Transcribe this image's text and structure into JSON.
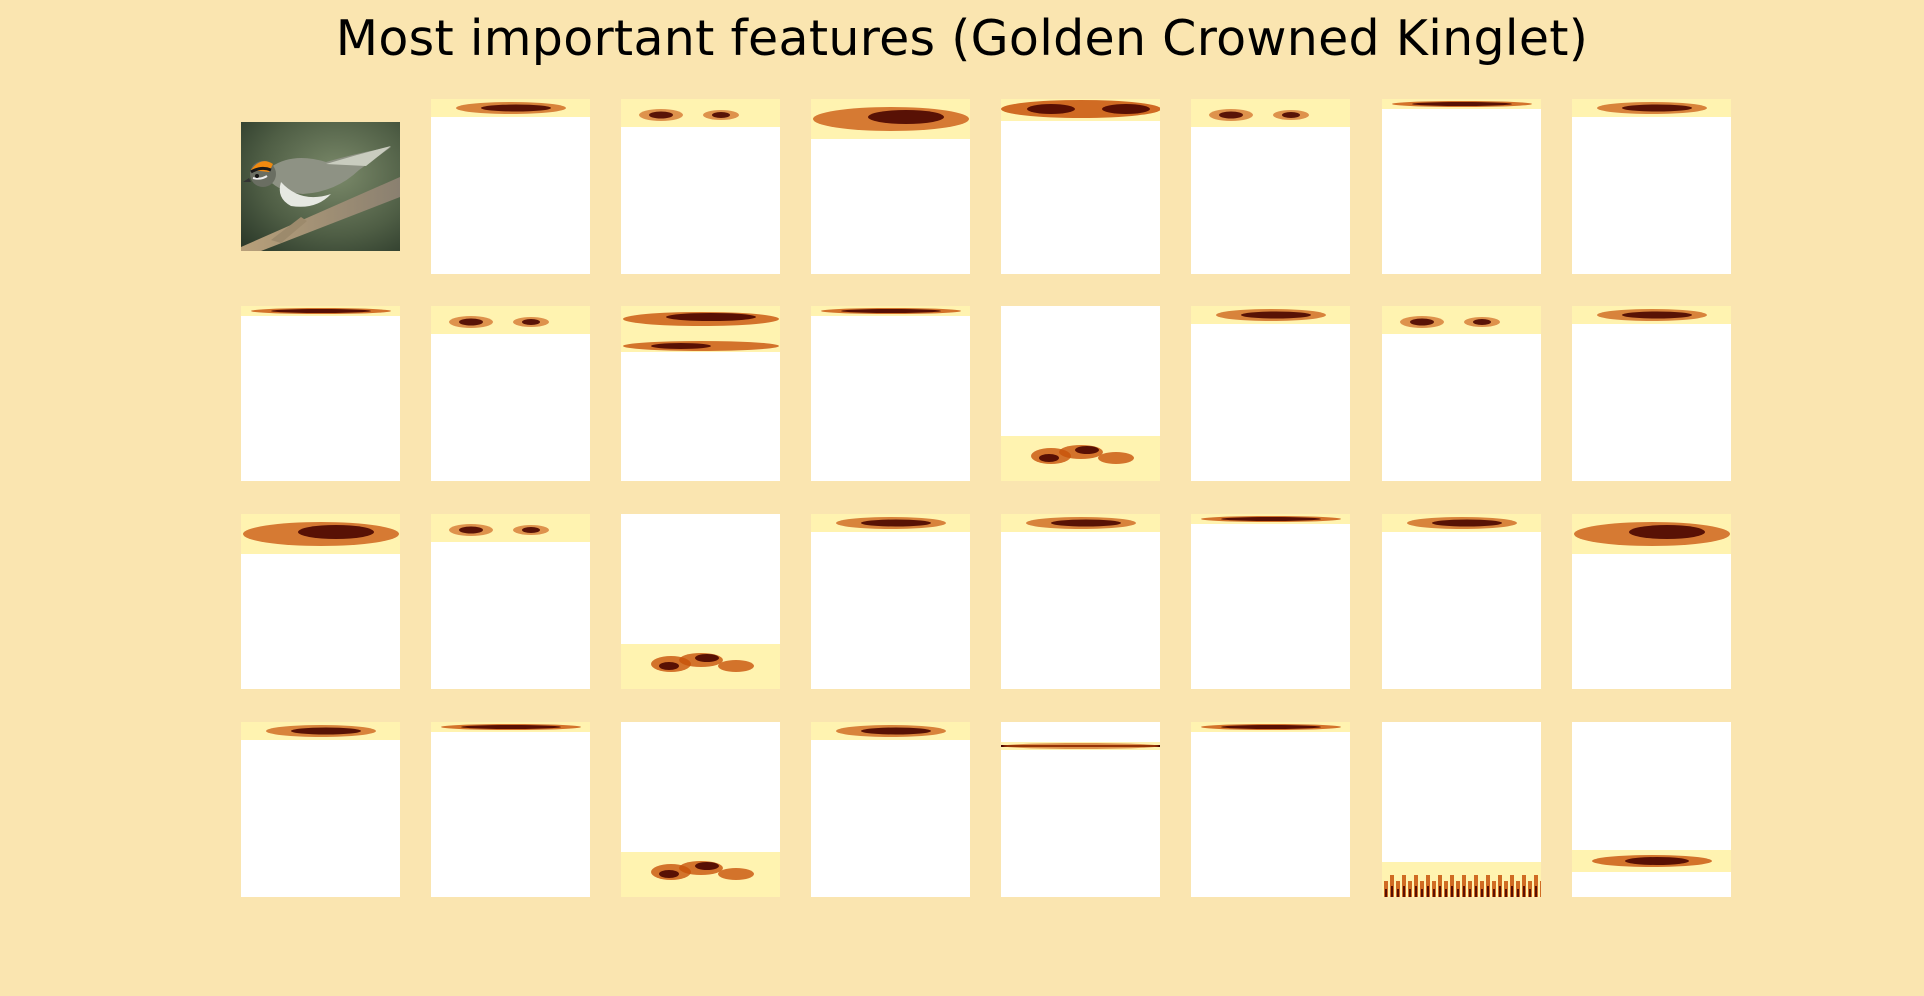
{
  "title": "Most important features (Golden Crowned Kinglet)",
  "colors": {
    "background": "#fae5b0",
    "cell_background": "#ffffff",
    "heat_dark": "#4a0500",
    "heat_mid": "#c8520a",
    "heat_light": "#fff3b0"
  },
  "photo": {
    "subject": "golden crowned kinglet",
    "icon": "bird-photo"
  },
  "heatmaps": [
    {
      "id": 1,
      "desc": "top-band"
    },
    {
      "id": 2,
      "desc": "two-spots-top"
    },
    {
      "id": 3,
      "desc": "wide-top"
    },
    {
      "id": 4,
      "desc": "wide-top-dark"
    },
    {
      "id": 5,
      "desc": "two-spots-top"
    },
    {
      "id": 6,
      "desc": "thin-top"
    },
    {
      "id": 7,
      "desc": "top-band"
    },
    {
      "id": 8,
      "desc": "thin-top"
    },
    {
      "id": 9,
      "desc": "two-spots-top"
    },
    {
      "id": 10,
      "desc": "double-band-top"
    },
    {
      "id": 11,
      "desc": "thin-top"
    },
    {
      "id": 12,
      "desc": "bottom-blobs"
    },
    {
      "id": 13,
      "desc": "top-band"
    },
    {
      "id": 14,
      "desc": "two-spots-top"
    },
    {
      "id": 15,
      "desc": "top-band"
    },
    {
      "id": 16,
      "desc": "wide-top"
    },
    {
      "id": 17,
      "desc": "two-spots-top"
    },
    {
      "id": 18,
      "desc": "bottom-blobs"
    },
    {
      "id": 19,
      "desc": "top-band"
    },
    {
      "id": 20,
      "desc": "top-band"
    },
    {
      "id": 21,
      "desc": "thin-top"
    },
    {
      "id": 22,
      "desc": "top-band"
    },
    {
      "id": 23,
      "desc": "wide-top"
    },
    {
      "id": 24,
      "desc": "top-band"
    },
    {
      "id": 25,
      "desc": "thin-top"
    },
    {
      "id": 26,
      "desc": "bottom-blobs"
    },
    {
      "id": 27,
      "desc": "top-band"
    },
    {
      "id": 28,
      "desc": "thin-line"
    },
    {
      "id": 29,
      "desc": "thin-top"
    },
    {
      "id": 30,
      "desc": "bottom-fringe"
    },
    {
      "id": 31,
      "desc": "mid-band"
    }
  ]
}
